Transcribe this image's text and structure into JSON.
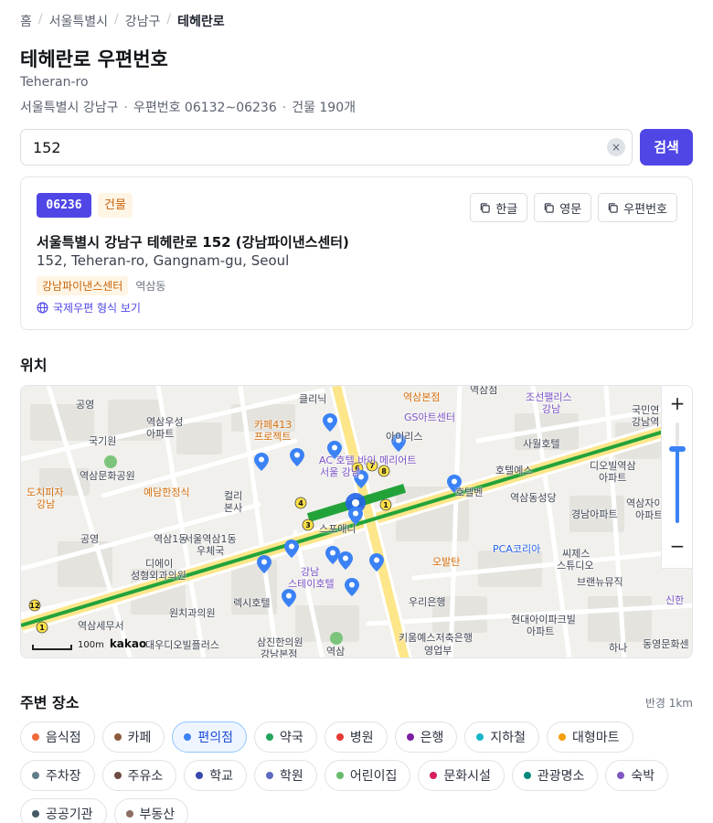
{
  "breadcrumb": {
    "home": "홈",
    "city": "서울특별시",
    "district": "강남구",
    "current": "테헤란로"
  },
  "header": {
    "title": "테헤란로 우편번호",
    "romanized": "Teheran-ro",
    "meta_region": "서울특별시 강남구",
    "meta_zip": "우편번호 06132~06236",
    "meta_buildings": "건물 190개"
  },
  "search": {
    "value": "152",
    "clear_icon": "×",
    "button_label": "검색"
  },
  "result": {
    "zipcode": "06236",
    "type_badge": "건물",
    "copy_buttons": [
      "한글",
      "영문",
      "우편번호"
    ],
    "address_ko": "서울특별시 강남구 테헤란로 152 (강남파이낸스센터)",
    "address_en": "152, Teheran-ro, Gangnam-gu, Seoul",
    "building_tag": "강남파이낸스센터",
    "dong": "역삼동",
    "intl_link": "국제우편 형식 보기"
  },
  "map": {
    "section_title": "위치",
    "scale_label": "100m",
    "provider": "kakao",
    "zoom_in": "+",
    "zoom_out": "−",
    "labels": [
      {
        "text": "공영",
        "style": ""
      },
      {
        "text": "국기원",
        "style": ""
      },
      {
        "text": "역삼우성",
        "style": ""
      },
      {
        "text": "아파트",
        "style": ""
      },
      {
        "text": "역삼문화공원",
        "style": ""
      },
      {
        "text": "도치피자",
        "style": "orange"
      },
      {
        "text": "강남",
        "style": "orange"
      },
      {
        "text": "예담한정식",
        "style": "orange"
      },
      {
        "text": "공영",
        "style": ""
      },
      {
        "text": "카페413",
        "style": "orange"
      },
      {
        "text": "프로젝트",
        "style": "orange"
      },
      {
        "text": "컬리",
        "style": ""
      },
      {
        "text": "본사",
        "style": ""
      },
      {
        "text": "역삼1동",
        "style": ""
      },
      {
        "text": "서울역삼1동",
        "style": ""
      },
      {
        "text": "우체국",
        "style": ""
      },
      {
        "text": "디에이",
        "style": ""
      },
      {
        "text": "성형외과의원",
        "style": ""
      },
      {
        "text": "원치과의원",
        "style": ""
      },
      {
        "text": "렉시호텔",
        "style": ""
      },
      {
        "text": "역삼세무서",
        "style": ""
      },
      {
        "text": "대우디오빌플러스",
        "style": ""
      },
      {
        "text": "삼진한의원",
        "style": ""
      },
      {
        "text": "강남본점",
        "style": ""
      },
      {
        "text": "AC 호텔 바이 메리어트",
        "style": "purple"
      },
      {
        "text": "서울 강남",
        "style": "purple"
      },
      {
        "text": "GS아트센터",
        "style": "purple"
      },
      {
        "text": "스포애니",
        "style": ""
      },
      {
        "text": "강남",
        "style": "purple"
      },
      {
        "text": "스테이호텔",
        "style": "purple"
      },
      {
        "text": "역삼",
        "style": ""
      },
      {
        "text": "오발탄",
        "style": "orange"
      },
      {
        "text": "우리은행",
        "style": ""
      },
      {
        "text": "키움예스저축은행",
        "style": ""
      },
      {
        "text": "영업부",
        "style": ""
      },
      {
        "text": "사월호텔",
        "style": ""
      },
      {
        "text": "호텔예스",
        "style": ""
      },
      {
        "text": "호텔벤",
        "style": ""
      },
      {
        "text": "역삼동성당",
        "style": ""
      },
      {
        "text": "PCA코리아",
        "style": "blue"
      },
      {
        "text": "씨제스",
        "style": ""
      },
      {
        "text": "스튜디오",
        "style": ""
      },
      {
        "text": "브랜뉴뮤직",
        "style": ""
      },
      {
        "text": "현대아이파크빌",
        "style": ""
      },
      {
        "text": "아파트",
        "style": ""
      },
      {
        "text": "하나",
        "style": ""
      },
      {
        "text": "동영문화센",
        "style": ""
      },
      {
        "text": "조선팰리스",
        "style": "purple"
      },
      {
        "text": "강남",
        "style": "purple"
      },
      {
        "text": "디오빌역삼",
        "style": ""
      },
      {
        "text": "아파트",
        "style": ""
      },
      {
        "text": "경남아파트",
        "style": ""
      },
      {
        "text": "역삼자이",
        "style": ""
      },
      {
        "text": "아파트",
        "style": ""
      },
      {
        "text": "국민연",
        "style": ""
      },
      {
        "text": "강남역",
        "style": ""
      },
      {
        "text": "신한",
        "style": "purple"
      },
      {
        "text": "역삼점",
        "style": ""
      },
      {
        "text": "역삼본점",
        "style": "orange"
      },
      {
        "text": "클리닉",
        "style": ""
      },
      {
        "text": "아이리스",
        "style": ""
      },
      {
        "text": "역삼",
        "style": ""
      },
      {
        "text": "트랜드센터",
        "style": ""
      },
      {
        "text": "역삼프리마빌",
        "style": ""
      },
      {
        "text": "언주로",
        "style": ""
      }
    ]
  },
  "nearby": {
    "section_title": "주변 장소",
    "radius": "반경 1km",
    "categories": [
      {
        "label": "음식점",
        "color": "#f26b3a"
      },
      {
        "label": "카페",
        "color": "#8b5a3c"
      },
      {
        "label": "편의점",
        "color": "#3b82f6"
      },
      {
        "label": "약국",
        "color": "#22a55a"
      },
      {
        "label": "병원",
        "color": "#e53935"
      },
      {
        "label": "은행",
        "color": "#7b1fa2"
      },
      {
        "label": "지하철",
        "color": "#16b5c9"
      },
      {
        "label": "대형마트",
        "color": "#f59e0b"
      },
      {
        "label": "주차장",
        "color": "#607d8b"
      },
      {
        "label": "주유소",
        "color": "#6d4c41"
      },
      {
        "label": "학교",
        "color": "#3949ab"
      },
      {
        "label": "학원",
        "color": "#5c6bc0"
      },
      {
        "label": "어린이집",
        "color": "#66bb6a"
      },
      {
        "label": "문화시설",
        "color": "#d81b60"
      },
      {
        "label": "관광명소",
        "color": "#00897b"
      },
      {
        "label": "숙박",
        "color": "#7e57c2"
      },
      {
        "label": "공공기관",
        "color": "#455a64"
      },
      {
        "label": "부동산",
        "color": "#8d6e63"
      }
    ],
    "active_category": "편의점"
  }
}
